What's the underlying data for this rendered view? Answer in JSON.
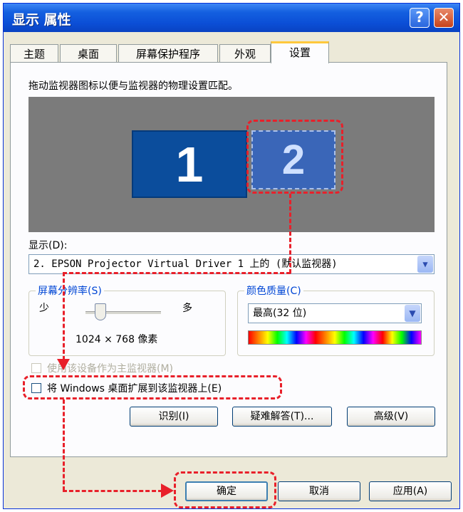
{
  "window": {
    "title": "显示 属性",
    "help_btn": "?",
    "close_btn": "✕"
  },
  "tabs": [
    {
      "label": "主题"
    },
    {
      "label": "桌面"
    },
    {
      "label": "屏幕保护程序"
    },
    {
      "label": "外观"
    },
    {
      "label": "设置"
    }
  ],
  "settings": {
    "instruction": "拖动监视器图标以便与监视器的物理设置匹配。",
    "monitor1": "1",
    "monitor2": "2",
    "display_label": "显示(D):",
    "display_value": "2. EPSON Projector Virtual Driver 1 上的 (默认监视器)",
    "resolution": {
      "title": "屏幕分辨率(S)",
      "less": "少",
      "more": "多",
      "value": "1024 × 768 像素"
    },
    "color_quality": {
      "title": "颜色质量(C)",
      "value": "最高(32 位)"
    },
    "primary_checkbox": "使用该设备作为主监视器(M)",
    "extend_checkbox": "将 Windows 桌面扩展到该监视器上(E)",
    "buttons": {
      "identify": "识别(I)",
      "troubleshoot": "疑难解答(T)...",
      "advanced": "高级(V)"
    }
  },
  "dialog_buttons": {
    "ok": "确定",
    "cancel": "取消",
    "apply": "应用(A)"
  },
  "colors": {
    "highlight": "#e8202a",
    "titlebar": "#0b4ed6",
    "monitor1": "#0b4d9c",
    "monitor2": "#3a66b8"
  }
}
